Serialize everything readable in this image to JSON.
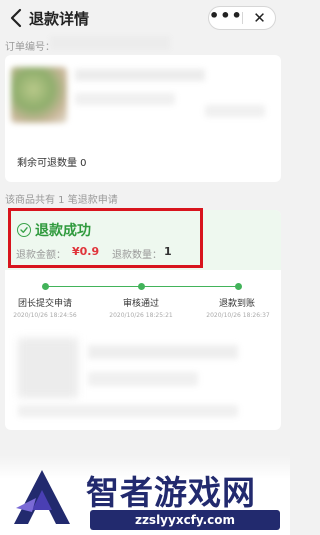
{
  "nav": {
    "title": "退款详情",
    "more": "•••",
    "close": "✕"
  },
  "order": {
    "label": "订单编号："
  },
  "product": {
    "remaining_text": "剩余可退数量 0"
  },
  "refund_count_text": "该商品共有 1 笔退款申请",
  "refund": {
    "status": "退款成功",
    "amount_label": "退款金额：",
    "amount_value": "¥0.9",
    "qty_label": "退款数量：",
    "qty_value": "1",
    "status_color": "#2f9a3d",
    "amount_color": "#e0343b"
  },
  "progress": {
    "steps": [
      {
        "label": "团长提交申请",
        "time": "2020/10/26 18:24:56"
      },
      {
        "label": "审核通过",
        "time": "2020/10/26 18:25:21"
      },
      {
        "label": "退款到账",
        "time": "2020/10/26 18:26:37"
      }
    ]
  },
  "watermark": {
    "text": "智者游戏网",
    "url": "zzslyyxcfy.com"
  }
}
